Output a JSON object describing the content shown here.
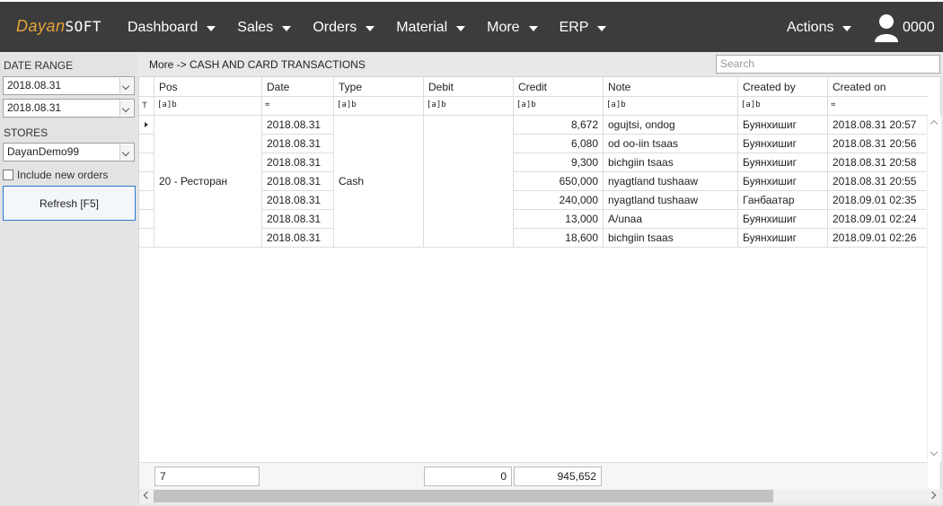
{
  "app": {
    "logo_part1": "Dayan",
    "logo_part2": "SOFT"
  },
  "nav": [
    {
      "label": "Dashboard"
    },
    {
      "label": "Sales"
    },
    {
      "label": "Orders"
    },
    {
      "label": "Material"
    },
    {
      "label": "More"
    },
    {
      "label": "ERP"
    }
  ],
  "actions_label": "Actions",
  "user": {
    "code": "0000"
  },
  "left": {
    "date_range_label": "DATE RANGE",
    "date_from": "2018.08.31",
    "date_to": "2018.08.31",
    "stores_label": "STORES",
    "store_value": "DayanDemo99",
    "include_new_orders_label": "Include new orders",
    "refresh_label": "Refresh [F5]"
  },
  "breadcrumb": "More -> CASH AND CARD TRANSACTIONS",
  "search_placeholder": "Search",
  "table": {
    "columns": [
      "Pos",
      "Date",
      "Type",
      "Debit",
      "Credit",
      "Note",
      "Created by",
      "Created on"
    ],
    "filters": [
      "[a]b",
      "=",
      "[a]b",
      "[a]b",
      "[a]b",
      "[a]b",
      "[a]b",
      "="
    ],
    "pos_value": "20 - Ресторан",
    "type_value": "Cash",
    "rows": [
      {
        "date": "2018.08.31",
        "credit": "8,672",
        "note": "ogujtsi, ondog",
        "created_by": "Буянхишиг",
        "created_on": "2018.08.31 20:57"
      },
      {
        "date": "2018.08.31",
        "credit": "6,080",
        "note": "od oo-iin tsaas",
        "created_by": "Буянхишиг",
        "created_on": "2018.08.31 20:56"
      },
      {
        "date": "2018.08.31",
        "credit": "9,300",
        "note": "bichgiin tsaas",
        "created_by": "Буянхишиг",
        "created_on": "2018.08.31 20:58"
      },
      {
        "date": "2018.08.31",
        "credit": "650,000",
        "note": "nyagtland tushaaw",
        "created_by": "Буянхишиг",
        "created_on": "2018.08.31 20:55"
      },
      {
        "date": "2018.08.31",
        "credit": "240,000",
        "note": "nyagtland tushaaw",
        "created_by": "Ганбаатар",
        "created_on": "2018.09.01 02:35"
      },
      {
        "date": "2018.08.31",
        "credit": "13,000",
        "note": "A/unaa",
        "created_by": "Буянхишиг",
        "created_on": "2018.09.01 02:24"
      },
      {
        "date": "2018.08.31",
        "credit": "18,600",
        "note": "bichgiin tsaas",
        "created_by": "Буянхишиг",
        "created_on": "2018.09.01 02:26"
      }
    ],
    "footer": {
      "count": "7",
      "debit_total": "0",
      "credit_total": "945,652"
    }
  }
}
